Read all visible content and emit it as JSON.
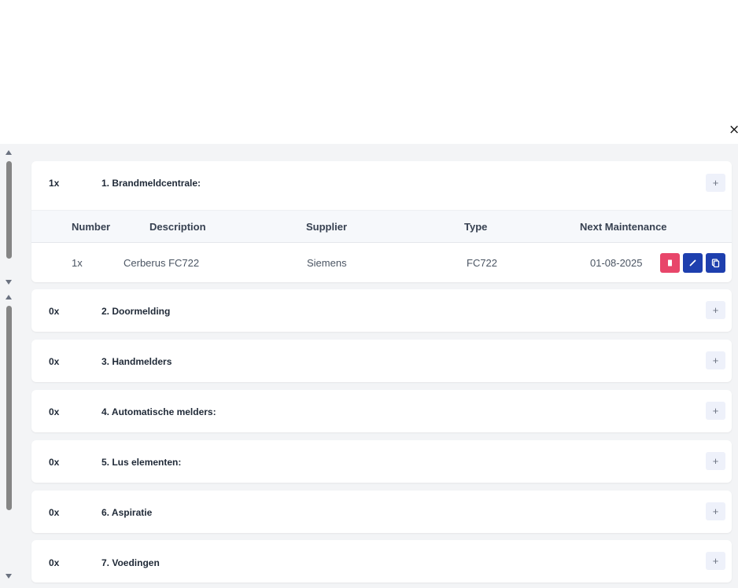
{
  "dialog": {
    "close_label": "×"
  },
  "table": {
    "headers": [
      "Number",
      "Description",
      "Supplier",
      "Type",
      "Next Maintenance"
    ],
    "rows": [
      {
        "number": "1x",
        "description": "Cerberus FC722",
        "supplier": "Siemens",
        "type": "FC722",
        "next_maintenance": "01-08-2025"
      }
    ],
    "action_icons": [
      "trash-icon",
      "pencil-icon",
      "copy-icon"
    ]
  },
  "sections": [
    {
      "count": "1x",
      "title": "1. Brandmeldcentrale:",
      "add_label": "+"
    },
    {
      "count": "0x",
      "title": "2. Doormelding",
      "add_label": "+"
    },
    {
      "count": "0x",
      "title": "3. Handmelders",
      "add_label": "+"
    },
    {
      "count": "0x",
      "title": "4. Automatische melders:",
      "add_label": "+"
    },
    {
      "count": "0x",
      "title": "5. Lus elementen:",
      "add_label": "+"
    },
    {
      "count": "0x",
      "title": "6. Aspiratie",
      "add_label": "+"
    },
    {
      "count": "0x",
      "title": "7. Voedingen",
      "add_label": "+"
    }
  ],
  "colors": {
    "delete": "#e8466a",
    "primary": "#1e3fae",
    "background": "#f3f4f6"
  }
}
